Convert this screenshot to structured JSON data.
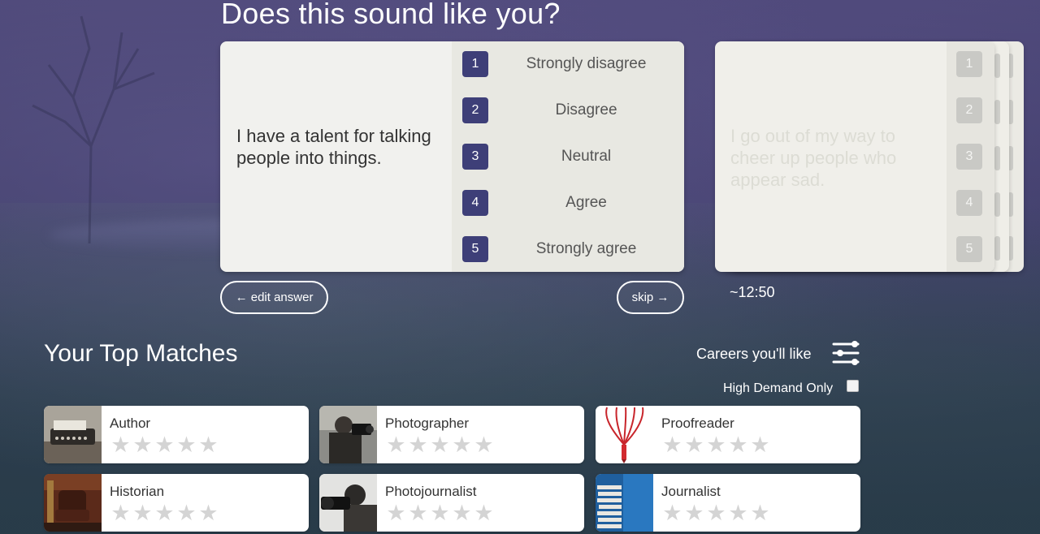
{
  "heading": "Does this sound like you?",
  "current_question": {
    "text": "I have a talent for talking people into things.",
    "options": [
      {
        "num": "1",
        "label": "Strongly disagree"
      },
      {
        "num": "2",
        "label": "Disagree"
      },
      {
        "num": "3",
        "label": "Neutral"
      },
      {
        "num": "4",
        "label": "Agree"
      },
      {
        "num": "5",
        "label": "Strongly agree"
      }
    ]
  },
  "next_question": {
    "text": "I go out of my way to cheer up people who appear sad.",
    "nums": [
      "1",
      "2",
      "3",
      "4",
      "5"
    ]
  },
  "controls": {
    "edit_answer": "← edit answer",
    "skip": "skip →",
    "timer": "~12:50"
  },
  "matches": {
    "title": "Your Top Matches",
    "careers_label": "Careers you'll like",
    "high_demand_label": "High Demand Only",
    "high_demand_checked": false,
    "items": [
      {
        "title": "Author",
        "rating": 0
      },
      {
        "title": "Photographer",
        "rating": 0
      },
      {
        "title": "Proofreader",
        "rating": 0
      },
      {
        "title": "Historian",
        "rating": 0
      },
      {
        "title": "Photojournalist",
        "rating": 0
      },
      {
        "title": "Journalist",
        "rating": 0
      }
    ]
  },
  "colors": {
    "accent": "#3e3f78",
    "card_bg": "#f1f1ee",
    "star_empty": "#d4d4d4"
  },
  "icons": {
    "filter": "sliders-icon",
    "star": "star-icon"
  }
}
